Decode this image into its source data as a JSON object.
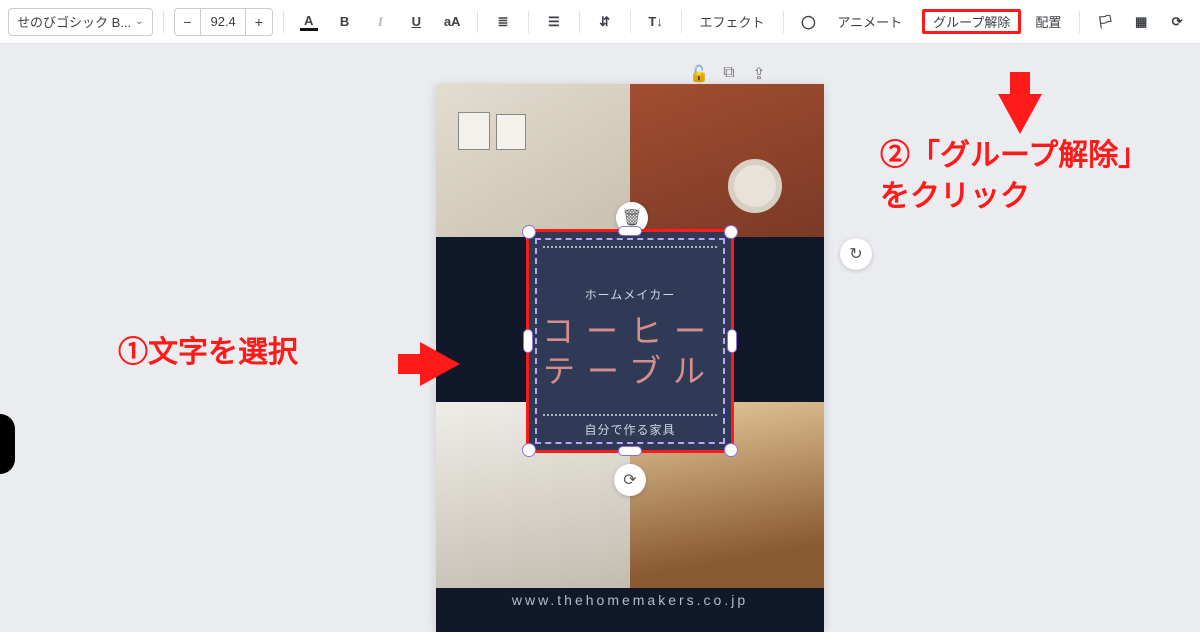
{
  "toolbar": {
    "font_name": "せのびゴシック B...",
    "minus": "−",
    "font_size": "92.4",
    "plus": "+",
    "text_color_A": "A",
    "bold": "B",
    "italic": "I",
    "underline": "U",
    "case": "aA",
    "effects": "エフェクト",
    "animate": "アニメート",
    "ungroup": "グループ解除",
    "position": "配置"
  },
  "obj_tools": {
    "lock": "🔓",
    "copy": "⧉",
    "share": "⇪"
  },
  "card": {
    "subtitle": "ホームメイカー",
    "title_l1": "コーヒー",
    "title_l2": "テーブル",
    "caption": "自分で作る家具",
    "url": "www.thehomemakers.co.jp"
  },
  "float": {
    "trash": "🗑",
    "rotate": "⟳",
    "redo": "↻"
  },
  "anno": {
    "step1": "①文字を選択",
    "step2_l1": "②「グループ解除」",
    "step2_l2": "をクリック"
  }
}
